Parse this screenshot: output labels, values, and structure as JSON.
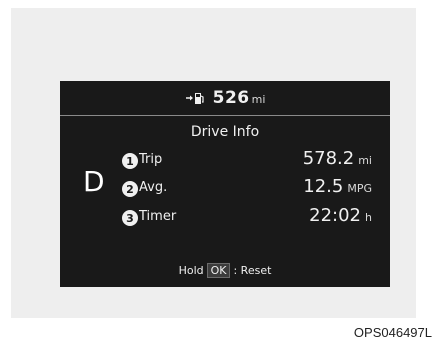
{
  "cluster": {
    "range": {
      "value": "526",
      "unit": "mi",
      "icon": "fuel-pump-arrow-icon"
    },
    "title": "Drive Info",
    "gear": "D",
    "rows": [
      {
        "index": "1",
        "label": "Trip",
        "value": "578.2",
        "unit": "mi"
      },
      {
        "index": "2",
        "label": "Avg.",
        "value": "12.5",
        "unit": "MPG"
      },
      {
        "index": "3",
        "label": "Timer",
        "value": "22:02",
        "unit": "h"
      }
    ],
    "hint": {
      "prefix": "Hold",
      "key": "OK",
      "suffix": ": Reset"
    }
  },
  "figure_code": "OPS046497L",
  "colors": {
    "screen": "#191919",
    "text": "#f0f0f0",
    "panel": "#eeeeee"
  }
}
